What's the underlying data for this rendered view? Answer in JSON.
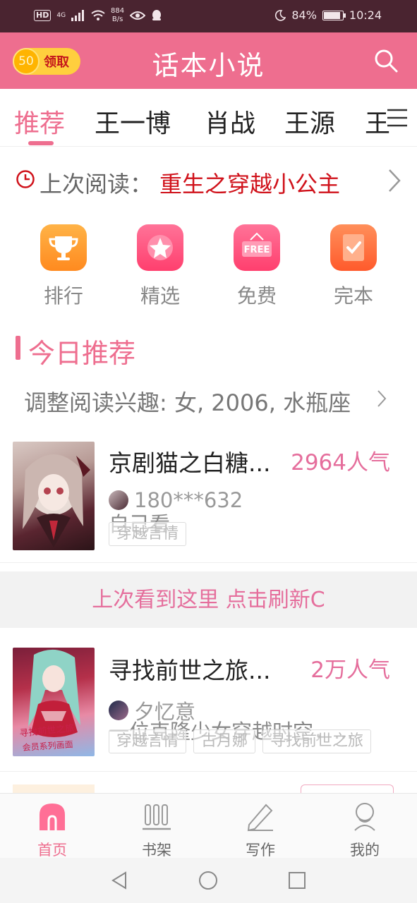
{
  "status_bar": {
    "hd": "HD",
    "network": "4G",
    "speed_value": "884",
    "speed_unit": "B/s",
    "battery": "84%",
    "battery_level": 0.84,
    "time": "10:24"
  },
  "header": {
    "coin_value": "50",
    "claim_label": "领取",
    "title": "话本小说",
    "search_icon": "search-icon"
  },
  "tabs": [
    {
      "label": "推荐",
      "active": true
    },
    {
      "label": "王一博",
      "active": false
    },
    {
      "label": "肖战",
      "active": false
    },
    {
      "label": "王源",
      "active": false
    },
    {
      "label": "王",
      "active": false
    }
  ],
  "last_read": {
    "prefix": "上次阅读：",
    "title": "重生之穿越小公主"
  },
  "categories": [
    {
      "label": "排行",
      "icon": "trophy-icon",
      "color": "#ff9a2e"
    },
    {
      "label": "精选",
      "icon": "star-icon",
      "color": "#ff4f7e"
    },
    {
      "label": "免费",
      "icon": "free-sign-icon",
      "color": "#ff4f7e",
      "badge": "FREE"
    },
    {
      "label": "完本",
      "icon": "check-book-icon",
      "color": "#ff7a45"
    }
  ],
  "today": {
    "title": "今日推荐",
    "interest": "调整阅读兴趣: 女, 2006, 水瓶座"
  },
  "books": [
    {
      "title": "京剧猫之白糖...",
      "popularity": "2964人气",
      "author": "180***632",
      "description": "自己看",
      "tags": [
        "穿越言情"
      ]
    },
    {
      "title": "寻找前世之旅...",
      "popularity": "2万人气",
      "author": "夕忆意",
      "description": "一位克隆少女穿越时空，...",
      "tags": [
        "穿越言情",
        "古月娜",
        "寻找前世之旅"
      ]
    }
  ],
  "refresh": {
    "text": "上次看到这里 点击刷新C"
  },
  "bottom_nav": [
    {
      "label": "首页",
      "icon": "home-icon",
      "active": true
    },
    {
      "label": "书架",
      "icon": "bookshelf-icon",
      "active": false
    },
    {
      "label": "写作",
      "icon": "pencil-icon",
      "active": false
    },
    {
      "label": "我的",
      "icon": "profile-icon",
      "active": false
    }
  ],
  "colors": {
    "accent": "#ee6e8f",
    "status_bar": "#4a2430",
    "highlight_red": "#d0121b"
  }
}
